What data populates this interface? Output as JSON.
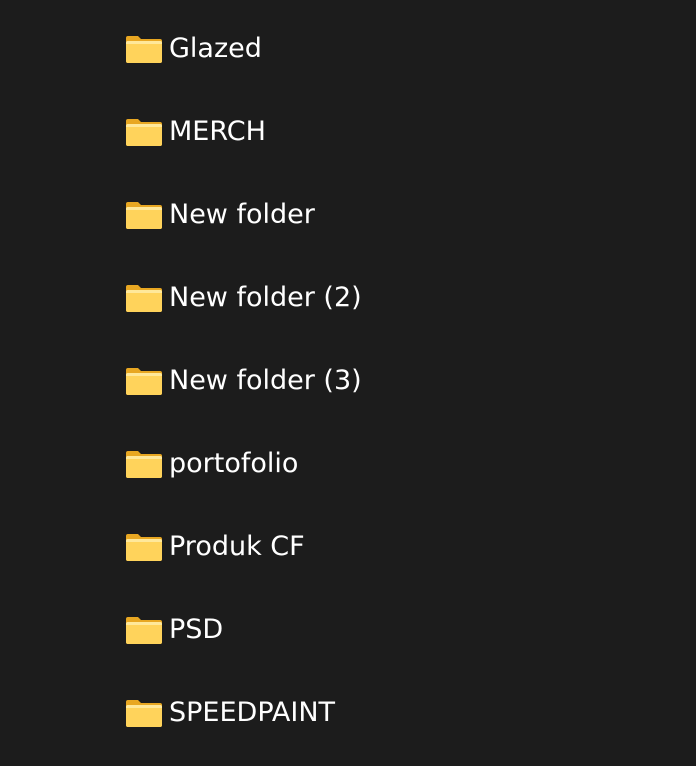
{
  "folders": [
    {
      "label": "Glazed"
    },
    {
      "label": "MERCH"
    },
    {
      "label": "New folder"
    },
    {
      "label": "New folder (2)"
    },
    {
      "label": "New folder (3)"
    },
    {
      "label": "portofolio"
    },
    {
      "label": "Produk CF"
    },
    {
      "label": "PSD"
    },
    {
      "label": "SPEEDPAINT"
    }
  ],
  "icon": "folder-icon",
  "colors": {
    "background": "#1c1c1c",
    "text": "#ffffff",
    "folder_front": "#ffd35b",
    "folder_back": "#e8a722"
  }
}
